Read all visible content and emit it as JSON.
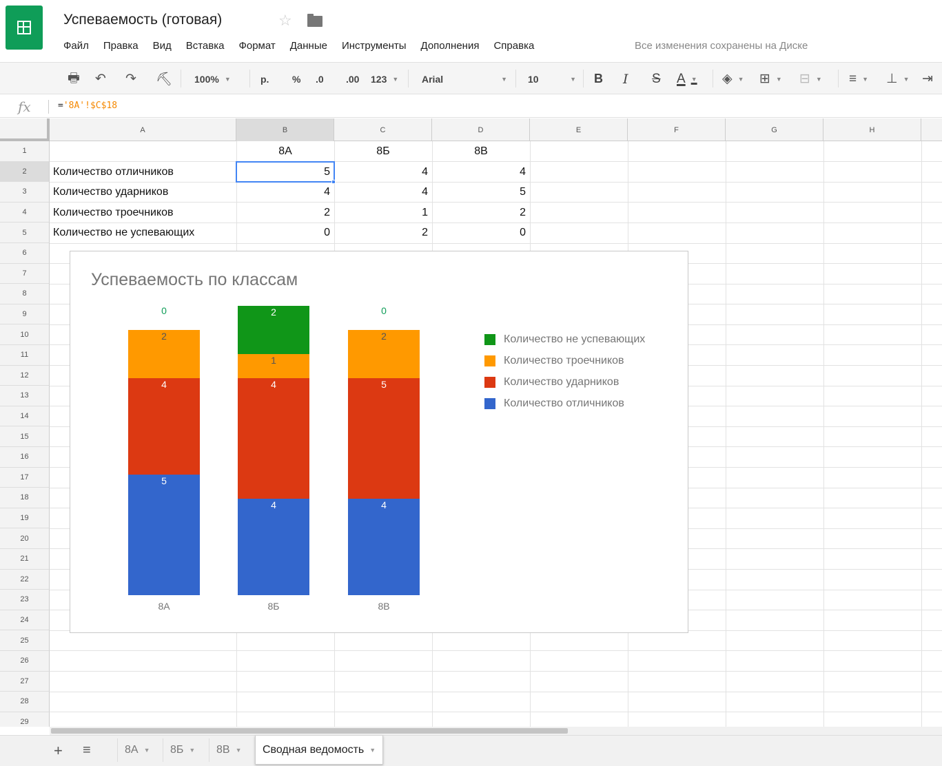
{
  "header": {
    "title": "Успеваемость (готовая)",
    "save_status": "Все изменения сохранены на Диске",
    "menu": [
      "Файл",
      "Правка",
      "Вид",
      "Вставка",
      "Формат",
      "Данные",
      "Инструменты",
      "Дополнения",
      "Справка"
    ]
  },
  "toolbar": {
    "zoom": "100%",
    "currency": "р.",
    "percent": "%",
    "decrease_decimal": ".0",
    "increase_decimal": ".00",
    "more_formats": "123",
    "font": "Arial",
    "font_size": "10",
    "bold": "B",
    "italic": "I",
    "strikethrough": "S",
    "text_color": "A"
  },
  "formula_bar": {
    "prefix": "=",
    "reference": "'8A'!$C$18"
  },
  "grid": {
    "columns": [
      "A",
      "B",
      "C",
      "D",
      "E",
      "F",
      "G",
      "H"
    ],
    "rows": [
      "1",
      "2",
      "3",
      "4",
      "5",
      "6",
      "7",
      "8",
      "9",
      "10",
      "11",
      "12",
      "13",
      "14",
      "15",
      "16",
      "17",
      "18",
      "19",
      "20",
      "21",
      "22",
      "23",
      "24",
      "25",
      "26",
      "27",
      "28",
      "29"
    ],
    "selected_cell": "B2",
    "headers": [
      "8А",
      "8Б",
      "8В"
    ],
    "data": [
      {
        "label": "Количество отличников",
        "values": [
          "5",
          "4",
          "4"
        ]
      },
      {
        "label": "Количество ударников",
        "values": [
          "4",
          "4",
          "5"
        ]
      },
      {
        "label": "Количество троечников",
        "values": [
          "2",
          "1",
          "2"
        ]
      },
      {
        "label": "Количество не успевающих",
        "values": [
          "0",
          "2",
          "0"
        ]
      }
    ]
  },
  "chart_data": {
    "type": "bar",
    "stacked": true,
    "title": "Успеваемость по классам",
    "categories": [
      "8А",
      "8Б",
      "8В"
    ],
    "series": [
      {
        "name": "Количество отличников",
        "values": [
          5,
          4,
          4
        ],
        "color": "#3366cc"
      },
      {
        "name": "Количество ударников",
        "values": [
          4,
          5,
          5
        ],
        "color": "#dc3912"
      },
      {
        "name": "Количество троечников",
        "values": [
          2,
          1,
          2
        ],
        "color": "#ff9900"
      },
      {
        "name": "Количество не успевающих",
        "values": [
          0,
          2,
          0
        ],
        "color": "#109618"
      }
    ],
    "data_labels": [
      [
        "5",
        "4",
        "2",
        "0"
      ],
      [
        "4",
        "4",
        "1",
        "2"
      ],
      [
        "4",
        "5",
        "2",
        "0"
      ]
    ],
    "legend": [
      "Количество не успевающих",
      "Количество троечников",
      "Количество ударников",
      "Количество отличников"
    ],
    "legend_position": "right",
    "grid": false
  },
  "sheets": {
    "tabs": [
      "8А",
      "8Б",
      "8В",
      "Сводная ведомость"
    ],
    "active": "Сводная ведомость"
  }
}
